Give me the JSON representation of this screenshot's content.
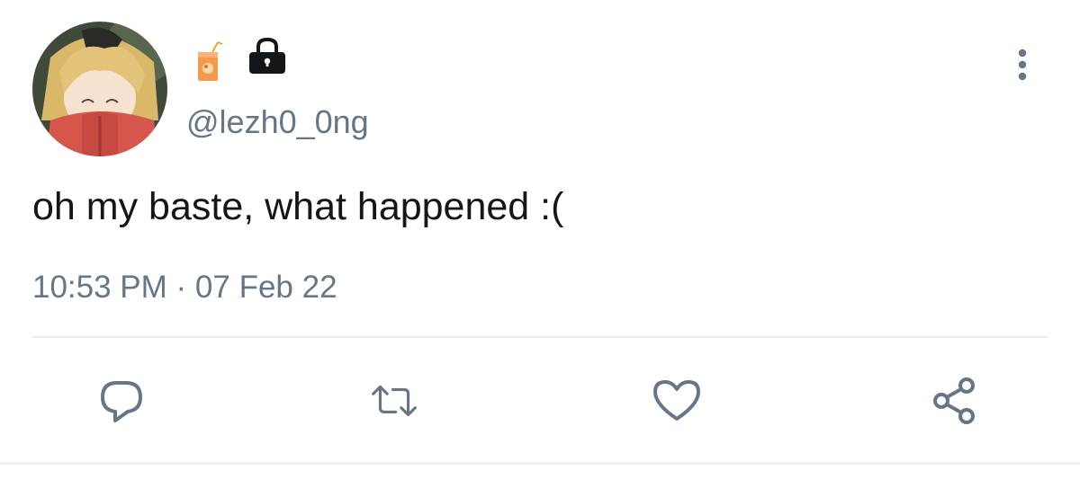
{
  "tweet": {
    "handle": "@lezh0_0ng",
    "text": "oh my baste, what happened :(",
    "time": "10:53 PM",
    "separator": " · ",
    "date": "07 Feb 22"
  },
  "icons": {
    "name_emoji_1": "juice-box-icon",
    "name_emoji_2": "lock-icon",
    "more": "more-vertical-icon",
    "reply": "reply-icon",
    "retweet": "retweet-icon",
    "like": "heart-icon",
    "share": "share-icon"
  },
  "colors": {
    "text": "#14171a",
    "secondary": "#657786",
    "icon": "#657786",
    "divider": "#e6ecf0"
  }
}
